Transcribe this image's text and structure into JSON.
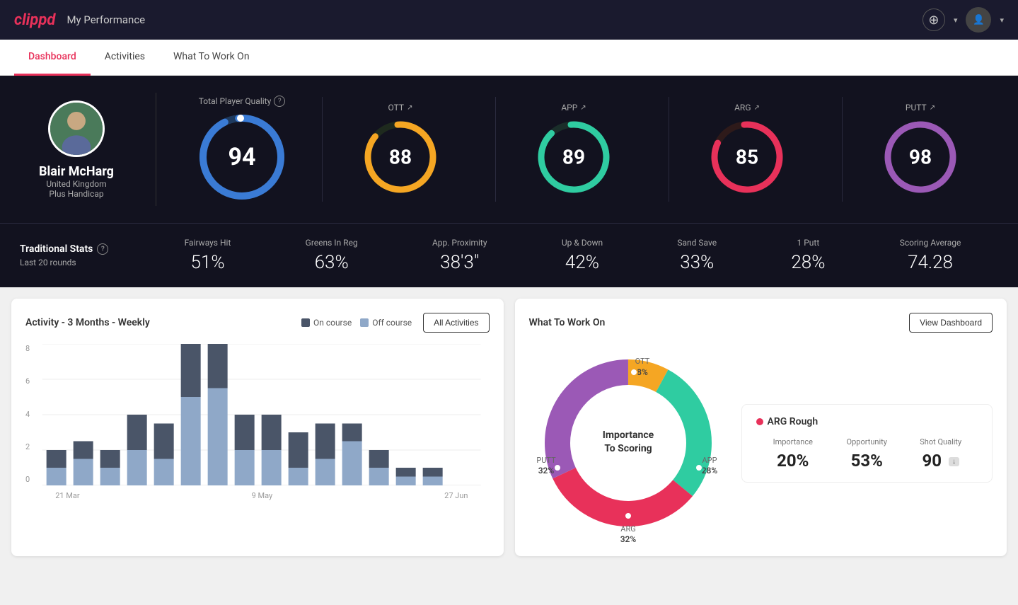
{
  "header": {
    "logo": "clippd",
    "title": "My Performance",
    "add_icon": "+",
    "avatar_icon": "👤"
  },
  "nav": {
    "tabs": [
      "Dashboard",
      "Activities",
      "What To Work On"
    ],
    "active": "Dashboard"
  },
  "player": {
    "name": "Blair McHarg",
    "country": "United Kingdom",
    "handicap": "Plus Handicap",
    "avatar_emoji": "🧍"
  },
  "total_quality": {
    "label": "Total Player Quality",
    "value": 94,
    "color": "#3a7bd5"
  },
  "scores": [
    {
      "label": "OTT",
      "value": 88,
      "color": "#f5a623",
      "bg": "#222"
    },
    {
      "label": "APP",
      "value": 89,
      "color": "#2fcca1",
      "bg": "#222"
    },
    {
      "label": "ARG",
      "value": 85,
      "color": "#e8315a",
      "bg": "#222"
    },
    {
      "label": "PUTT",
      "value": 98,
      "color": "#9b59b6",
      "bg": "#222"
    }
  ],
  "traditional_stats": {
    "title": "Traditional Stats",
    "subtitle": "Last 20 rounds",
    "stats": [
      {
        "label": "Fairways Hit",
        "value": "51%"
      },
      {
        "label": "Greens In Reg",
        "value": "63%"
      },
      {
        "label": "App. Proximity",
        "value": "38'3\""
      },
      {
        "label": "Up & Down",
        "value": "42%"
      },
      {
        "label": "Sand Save",
        "value": "33%"
      },
      {
        "label": "1 Putt",
        "value": "28%"
      },
      {
        "label": "Scoring Average",
        "value": "74.28"
      }
    ]
  },
  "activity_chart": {
    "title": "Activity - 3 Months - Weekly",
    "legend": {
      "on_course": "On course",
      "off_course": "Off course"
    },
    "all_activities_btn": "All Activities",
    "x_labels": [
      "21 Mar",
      "9 May",
      "27 Jun"
    ],
    "bars": [
      {
        "on": 1,
        "off": 1
      },
      {
        "on": 1,
        "off": 1.5
      },
      {
        "on": 1,
        "off": 1
      },
      {
        "on": 2,
        "off": 2
      },
      {
        "on": 2,
        "off": 1.5
      },
      {
        "on": 3,
        "off": 5
      },
      {
        "on": 3,
        "off": 5.5
      },
      {
        "on": 2,
        "off": 2
      },
      {
        "on": 2,
        "off": 2
      },
      {
        "on": 2,
        "off": 1
      },
      {
        "on": 2,
        "off": 1.5
      },
      {
        "on": 1,
        "off": 2.5
      },
      {
        "on": 1,
        "off": 1
      },
      {
        "on": 0.5,
        "off": 0.5
      },
      {
        "on": 0.5,
        "off": 0.5
      }
    ],
    "y_labels": [
      "8",
      "6",
      "4",
      "2",
      "0"
    ]
  },
  "work_on": {
    "title": "What To Work On",
    "view_dashboard_btn": "View Dashboard",
    "donut_center_label": "Importance\nTo Scoring",
    "segments": [
      {
        "label": "OTT",
        "pct": "8%",
        "color": "#f5a623"
      },
      {
        "label": "APP",
        "pct": "28%",
        "color": "#2fcca1"
      },
      {
        "label": "ARG",
        "pct": "32%",
        "color": "#e8315a"
      },
      {
        "label": "PUTT",
        "pct": "32%",
        "color": "#9b59b6"
      }
    ],
    "info_card": {
      "title": "ARG Rough",
      "color": "#e8315a",
      "metrics": [
        {
          "label": "Importance",
          "value": "20%"
        },
        {
          "label": "Opportunity",
          "value": "53%"
        },
        {
          "label": "Shot Quality",
          "value": "90",
          "badge": ""
        }
      ]
    }
  }
}
